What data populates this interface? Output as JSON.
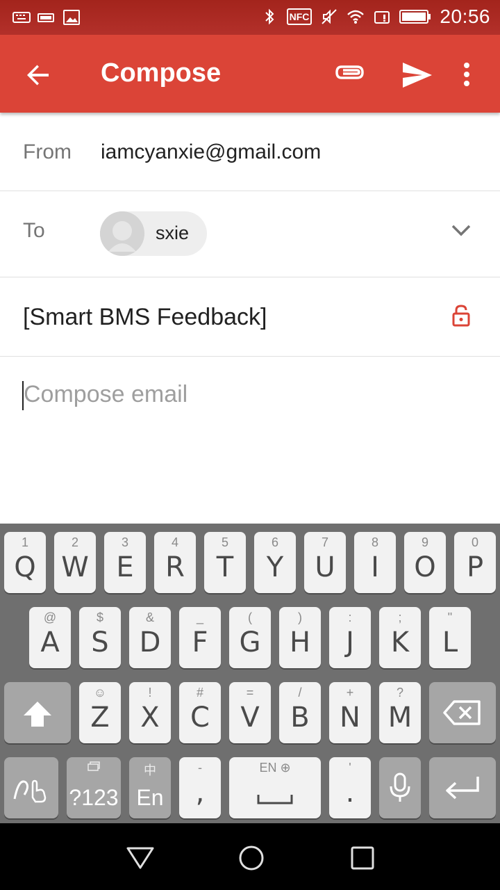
{
  "status_bar": {
    "time": "20:56",
    "icons_left": [
      "keyboard-icon",
      "battery-small-icon",
      "image-icon"
    ],
    "icons_right": [
      "bluetooth-icon",
      "nfc-icon",
      "mute-icon",
      "wifi-icon",
      "sim-alert-icon",
      "battery-icon"
    ],
    "nfc_label": "NFC"
  },
  "app_bar": {
    "title": "Compose",
    "color": "#db4437"
  },
  "compose": {
    "from_label": "From",
    "from_value": "iamcyanxie@gmail.com",
    "to_label": "To",
    "recipient_name": "sxie",
    "subject": "[Smart BMS Feedback]",
    "body_placeholder": "Compose email"
  },
  "keyboard": {
    "row1": [
      {
        "hint": "1",
        "label": "Q"
      },
      {
        "hint": "2",
        "label": "W"
      },
      {
        "hint": "3",
        "label": "E"
      },
      {
        "hint": "4",
        "label": "R"
      },
      {
        "hint": "5",
        "label": "T"
      },
      {
        "hint": "6",
        "label": "Y"
      },
      {
        "hint": "7",
        "label": "U"
      },
      {
        "hint": "8",
        "label": "I"
      },
      {
        "hint": "9",
        "label": "O"
      },
      {
        "hint": "0",
        "label": "P"
      }
    ],
    "row2": [
      {
        "hint": "@",
        "label": "A"
      },
      {
        "hint": "$",
        "label": "S"
      },
      {
        "hint": "&",
        "label": "D"
      },
      {
        "hint": "_",
        "label": "F"
      },
      {
        "hint": "(",
        "label": "G"
      },
      {
        "hint": ")",
        "label": "H"
      },
      {
        "hint": ":",
        "label": "J"
      },
      {
        "hint": ";",
        "label": "K"
      },
      {
        "hint": "\"",
        "label": "L"
      }
    ],
    "row3": [
      {
        "hint": "☺",
        "label": "Z"
      },
      {
        "hint": "!",
        "label": "X"
      },
      {
        "hint": "#",
        "label": "C"
      },
      {
        "hint": "=",
        "label": "V"
      },
      {
        "hint": "/",
        "label": "B"
      },
      {
        "hint": "+",
        "label": "N"
      },
      {
        "hint": "?",
        "label": "M"
      }
    ],
    "symbols_label": "?123",
    "lang_label": "En",
    "lang_hint": "中",
    "comma_label": ",",
    "comma_hint": "-",
    "space_hint": "EN ⊕",
    "period_label": ".",
    "period_hint": "'"
  }
}
